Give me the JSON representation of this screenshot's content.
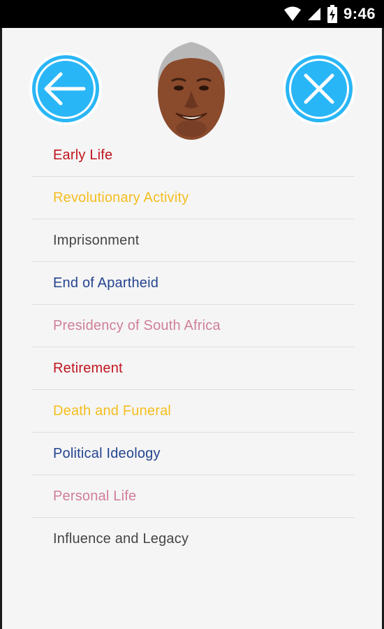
{
  "status_bar": {
    "time": "9:46",
    "icons": [
      "wifi-icon",
      "cell-signal-icon",
      "battery-charging-icon"
    ]
  },
  "header": {
    "back_button": {
      "icon": "arrow-left-icon",
      "color": "#29b6f6"
    },
    "close_button": {
      "icon": "close-icon",
      "color": "#29b6f6"
    },
    "portrait": {
      "icon": "portrait-image"
    }
  },
  "menu": {
    "items": [
      {
        "label": "Early Life",
        "color": "#c0141f"
      },
      {
        "label": "Revolutionary Activity",
        "color": "#f5bd1f"
      },
      {
        "label": "Imprisonment",
        "color": "#444444"
      },
      {
        "label": "End of Apartheid",
        "color": "#24448f"
      },
      {
        "label": "Presidency of South Africa",
        "color": "#cf7f97"
      },
      {
        "label": "Retirement",
        "color": "#c0141f"
      },
      {
        "label": "Death and Funeral",
        "color": "#f5bd1f"
      },
      {
        "label": "Political Ideology",
        "color": "#24448f"
      },
      {
        "label": "Personal Life",
        "color": "#cf7f97"
      },
      {
        "label": "Influence and Legacy",
        "color": "#444444"
      }
    ]
  }
}
